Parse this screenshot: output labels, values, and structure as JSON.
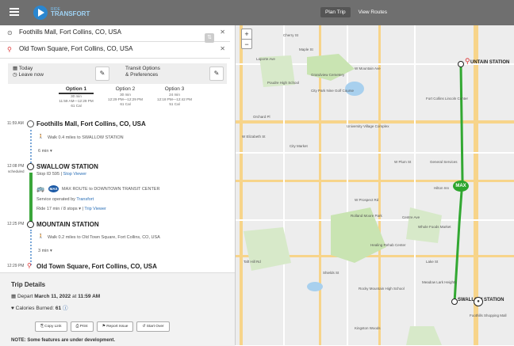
{
  "topbar": {
    "logo_small": "RIDE",
    "logo_big": "TRANSFORT",
    "tabs": [
      {
        "label": "Plan Trip",
        "active": true
      },
      {
        "label": "View Routes",
        "active": false
      }
    ]
  },
  "trip": {
    "origin": "Foothills Mall, Fort Collins, CO, USA",
    "destination": "Old Town Square, Fort Collins, CO, USA",
    "swap_icon": "swap-icon"
  },
  "options": {
    "date_label": "Today",
    "leave_label": "Leave now",
    "transit_options_label": "Transit Options",
    "preferences_label": "& Preferences"
  },
  "routes": [
    {
      "name": "Option 1",
      "duration": "30 min",
      "times": "11:59 AM—12:29 PM",
      "cal": "61 Cal",
      "active": true
    },
    {
      "name": "Option 2",
      "duration": "30 min",
      "times": "12:29 PM—12:29 PM",
      "cal": "61 Cal",
      "active": false
    },
    {
      "name": "Option 3",
      "duration": "24 min",
      "times": "12:18 PM—12:42 PM",
      "cal": "51 Cal",
      "active": false
    }
  ],
  "itinerary": {
    "stop1_time": "11:59 AM",
    "stop1_name": "Foothills Mall, Fort Collins, CO, USA",
    "walk1": "Walk 0.4 miles to SWALLOW STATION",
    "walk1_dur": "6 min",
    "stop2_time": "12:08 PM",
    "stop2_sched": "scheduled",
    "stop2_name": "SWALLOW STATION",
    "stop2_id": "Stop ID 595",
    "stop2_viewer": "Stop Viewer",
    "max_badge": "MAX",
    "max_route": "MAX ROUTE to DOWNTOWN TRANSIT CENTER",
    "operated": "Service operated by",
    "operator": "Transfort",
    "ride": "Ride 17 min / 8 stops",
    "trip_viewer": "Trip Viewer",
    "stop3_time": "12:25 PM",
    "stop3_name": "MOUNTAIN STATION",
    "walk2": "Walk 0.2 miles to Old Town Square, Fort Collins, CO, USA",
    "walk2_dur": "3 min",
    "stop4_time": "12:29 PM",
    "stop4_name": "Old Town Square, Fort Collins, CO, USA"
  },
  "details": {
    "title": "Trip Details",
    "depart_label": "Depart",
    "depart_value": "March 11, 2022",
    "depart_at": "at",
    "depart_time": "11:59 AM",
    "cal_label": "Calories Burned:",
    "cal_value": "61",
    "buttons": [
      "Copy Link",
      "Print",
      "Report Issue",
      "Start Over"
    ],
    "note": "NOTE: Some features are under development."
  },
  "map": {
    "labels": [
      "Laporte Ave",
      "W Mountain Ave",
      "Poudre High School",
      "Grandview Cemetery",
      "City Park Nine Golf Course",
      "Orchard Pl",
      "W Elizabeth St",
      "City Market",
      "University Village Complex",
      "W Plum St",
      "W Prospect Rd",
      "Rolland Moore Park",
      "Centre Ave",
      "Healing Rehab Center",
      "Lake St",
      "Taft Hill Rd",
      "Shields St",
      "Whole Foods Market",
      "Rocky Mountain High School",
      "Meadow Lark Heights",
      "Kingston Woods",
      "Foothills Shopping Mall",
      "Fort Collins Lincoln Center",
      "General Services",
      "Hilton Inn",
      "Cherry St",
      "Maple St"
    ],
    "marker_max": "MAX",
    "marker_mountain": "UNTAIN STATION",
    "marker_swallow": "SWALLOW STATION"
  }
}
